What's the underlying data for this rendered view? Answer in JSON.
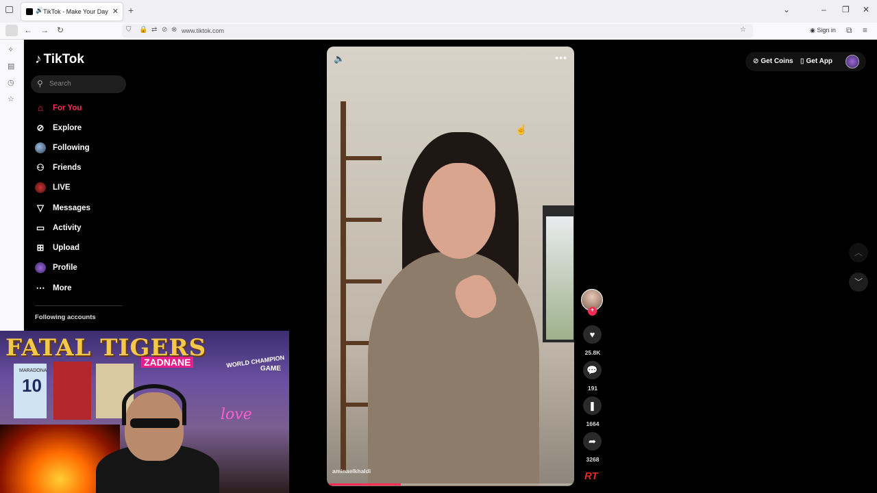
{
  "browser": {
    "tab_title": "TikTok - Make Your Day",
    "url": "www.tiktok.com",
    "sign_in": "Sign in"
  },
  "tiktok": {
    "logo": "TikTok",
    "search_placeholder": "Search",
    "menu": [
      {
        "label": "For You",
        "icon": "home-icon",
        "active": true
      },
      {
        "label": "Explore",
        "icon": "compass-icon"
      },
      {
        "label": "Following",
        "icon": "avatar-icon"
      },
      {
        "label": "Friends",
        "icon": "friends-icon"
      },
      {
        "label": "LIVE",
        "icon": "live-avatar-icon"
      },
      {
        "label": "Messages",
        "icon": "send-icon"
      },
      {
        "label": "Activity",
        "icon": "activity-icon"
      },
      {
        "label": "Upload",
        "icon": "upload-icon"
      },
      {
        "label": "Profile",
        "icon": "profile-avatar-icon"
      },
      {
        "label": "More",
        "icon": "more-icon"
      }
    ],
    "following_accounts_heading": "Following accounts",
    "accent_color": "#fe2c55"
  },
  "webcam": {
    "banner": "FATAL TIGERS",
    "name_tag": "ZADNANE",
    "jersey_name": "MARADONA",
    "jersey_number": "10",
    "sign_love": "love",
    "sign_world": "WORLD CHAMPION",
    "sign_game": "GAME"
  },
  "video": {
    "username": "aminaelkhaldi",
    "progress": 0.3
  },
  "actions": {
    "likes": "25.8K",
    "comments": "191",
    "saves": "1664",
    "shares": "3268"
  },
  "watermark": "RT",
  "top_right": {
    "get_coins": "Get Coins",
    "get_app": "Get App"
  }
}
